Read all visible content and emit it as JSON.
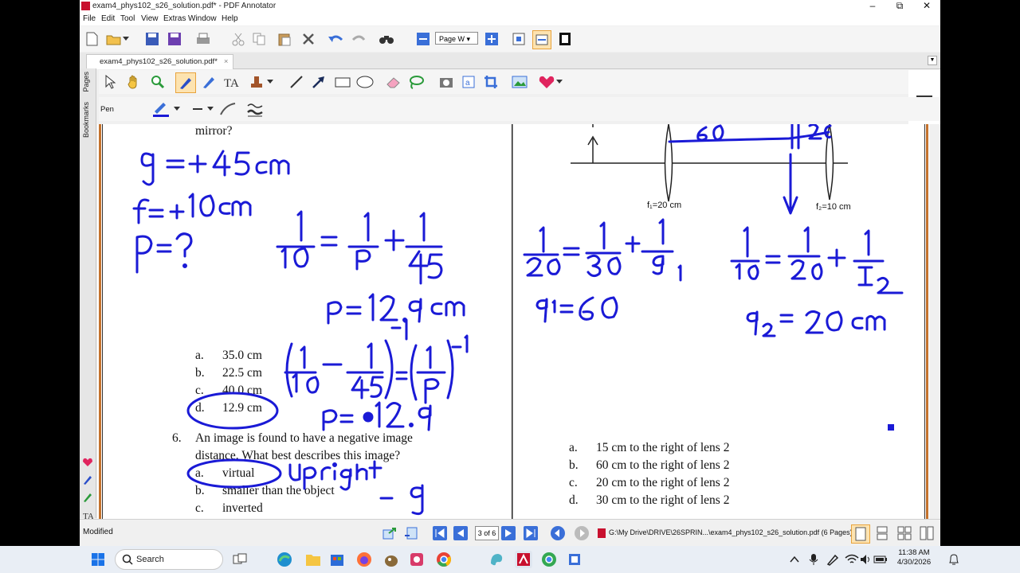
{
  "window": {
    "title": "exam4_phys102_s26_solution.pdf* - PDF Annotator",
    "minimize": "–",
    "restore": "⧉",
    "close": "✕"
  },
  "menu": [
    "File",
    "Edit",
    "Tool",
    "View",
    "Extras",
    "Window",
    "Help"
  ],
  "toolbar": {
    "zoom_value": "Page W",
    "zoom_arrow": "▾"
  },
  "tab": {
    "label": "exam4_phys102_s26_solution.pdf*",
    "close": "×",
    "overflow_arrow": "▼"
  },
  "sidebar": {
    "tabs": [
      "Pages",
      "Bookmarks"
    ]
  },
  "tool_options": {
    "pen_label": "Pen"
  },
  "document": {
    "left": {
      "question_tail": "mirror?",
      "choices": [
        {
          "letter": "a.",
          "text": "35.0 cm"
        },
        {
          "letter": "b.",
          "text": "22.5 cm"
        },
        {
          "letter": "c.",
          "text": "40.0 cm"
        },
        {
          "letter": "d.",
          "text": "12.9 cm"
        }
      ],
      "q6_number": "6.",
      "q6_line1": "An image is found to have a negative image",
      "q6_line2": "distance.  What best describes this image?",
      "q6_choices": [
        {
          "letter": "a.",
          "text": "virtual"
        },
        {
          "letter": "b.",
          "text": "smaller than the object"
        },
        {
          "letter": "c.",
          "text": "inverted"
        }
      ]
    },
    "right": {
      "lens1_label": "f₁=20 cm",
      "lens2_label": "f₂=10 cm",
      "choices": [
        {
          "letter": "a.",
          "text": "15 cm to the right of lens 2"
        },
        {
          "letter": "b.",
          "text": "60 cm to the right of lens 2"
        },
        {
          "letter": "c.",
          "text": "20 cm to the right of lens 2"
        },
        {
          "letter": "d.",
          "text": "30 cm to the right of lens 2"
        }
      ]
    },
    "ink_color": "#1a1ad6"
  },
  "status": {
    "state": "Modified",
    "page_indicator": "3 of 6",
    "file_path": "G:\\My Drive\\DRIVE\\26SPRIN...\\exam4_phys102_s26_solution.pdf (6 Pages)"
  },
  "taskbar": {
    "search_label": "Search",
    "time": "11:38 AM",
    "date": "4/30/2026"
  }
}
